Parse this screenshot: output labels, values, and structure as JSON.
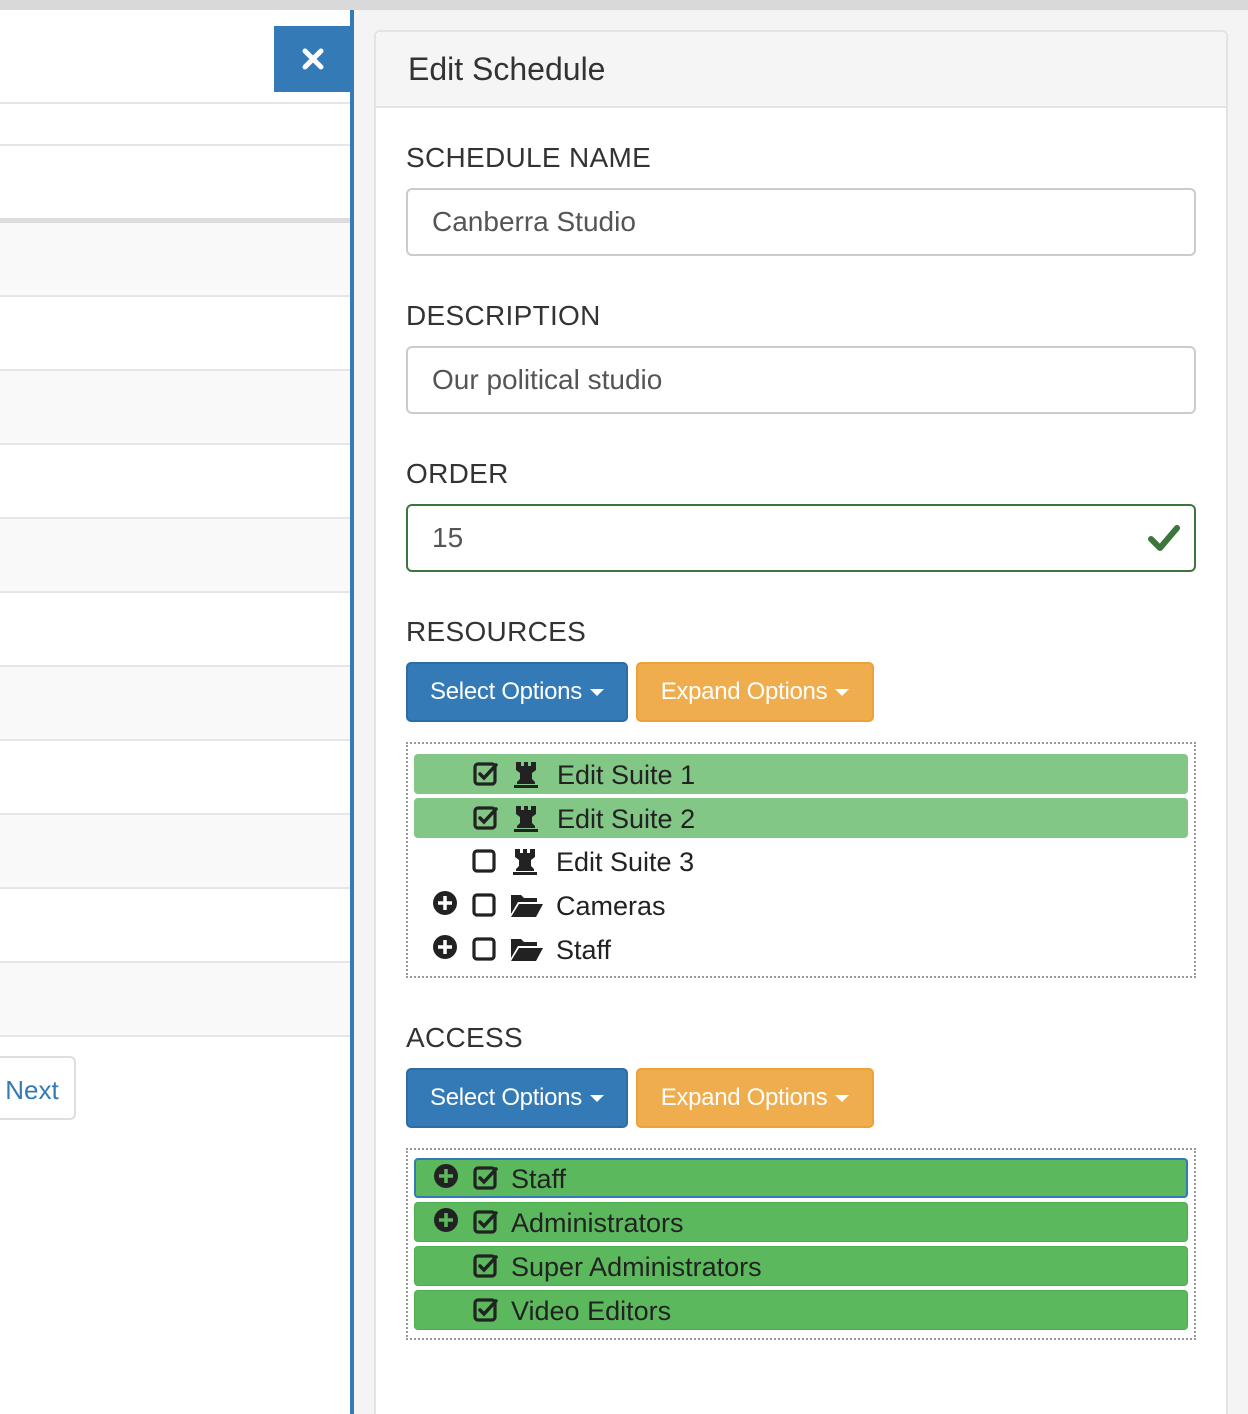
{
  "left": {
    "next_label": "Next"
  },
  "close_label": "×",
  "panel": {
    "title": "Edit Schedule"
  },
  "form": {
    "schedule_name": {
      "label": "SCHEDULE NAME",
      "value": "Canberra Studio"
    },
    "description": {
      "label": "DESCRIPTION",
      "value": "Our political studio"
    },
    "order": {
      "label": "ORDER",
      "value": "15"
    }
  },
  "resources": {
    "label": "RESOURCES",
    "select_label": "Select Options",
    "expand_label": "Expand Options",
    "items": [
      {
        "label": "Edit Suite 1",
        "checked": true,
        "icon": "rook-icon"
      },
      {
        "label": "Edit Suite 2",
        "checked": true,
        "icon": "rook-icon"
      },
      {
        "label": "Edit Suite 3",
        "checked": false,
        "icon": "rook-icon"
      },
      {
        "label": "Cameras",
        "checked": false,
        "icon": "folder-open-icon",
        "expandable": true
      },
      {
        "label": "Staff",
        "checked": false,
        "icon": "folder-open-icon",
        "expandable": true
      }
    ]
  },
  "access": {
    "label": "ACCESS",
    "select_label": "Select Options",
    "expand_label": "Expand Options",
    "items": [
      {
        "label": "Staff",
        "checked": true,
        "expandable": true
      },
      {
        "label": "Administrators",
        "checked": true,
        "expandable": true
      },
      {
        "label": "Super Administrators",
        "checked": true
      },
      {
        "label": "Video Editors",
        "checked": true
      }
    ]
  },
  "colors": {
    "primary": "#337ab7",
    "warning": "#f0ad4e",
    "success_text": "#3c763d",
    "selected_light": "#82c785",
    "selected": "#5cb85c"
  }
}
